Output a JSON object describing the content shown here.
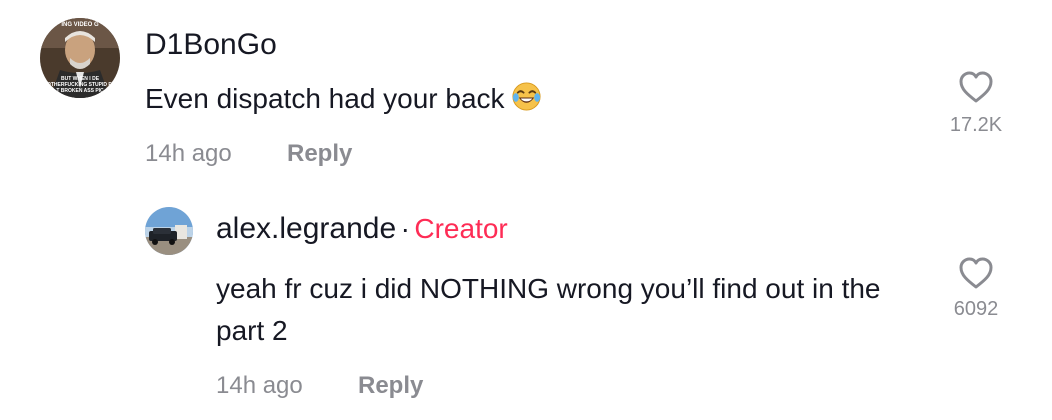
{
  "comment": {
    "username": "D1BonGo",
    "text": "Even dispatch had your back",
    "emoji": "face-with-tears-of-joy",
    "time": "14h ago",
    "reply_label": "Reply",
    "likes": "17.2K",
    "avatar_caption": {
      "top": "ING VIDEO G",
      "line1": "BUT WHEN I DE",
      "line2": "OTHERFUCKING STUPID PI",
      "line3": "T BROKEN ASS PIC"
    }
  },
  "reply": {
    "username": "alex.legrande",
    "separator": "·",
    "badge": "Creator",
    "text": "yeah fr cuz i did NOTHING wrong you’ll find out in the part 2",
    "time": "14h ago",
    "reply_label": "Reply",
    "likes": "6092"
  },
  "colors": {
    "text": "#161823",
    "muted": "#8a8b91",
    "creator": "#fe2c55",
    "icon": "#8a8b91"
  }
}
